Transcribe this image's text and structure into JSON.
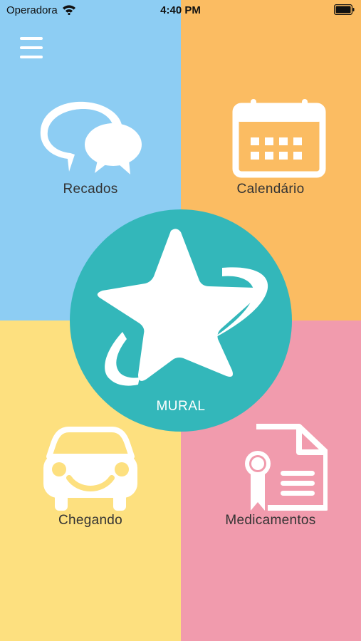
{
  "status_bar": {
    "carrier": "Operadora",
    "time": "4:40 PM",
    "icons": [
      "wifi-icon",
      "battery-icon"
    ]
  },
  "header": {
    "menu_icon": "hamburger-menu-icon"
  },
  "tiles": [
    {
      "label": "Recados",
      "icon": "speech-bubbles-icon",
      "color": "#8dcdf3"
    },
    {
      "label": "Calendário",
      "icon": "calendar-icon",
      "color": "#fbbc62"
    },
    {
      "label": "Chegando",
      "icon": "car-icon",
      "color": "#fde07f"
    },
    {
      "label": "Medicamentos",
      "icon": "prescription-document-icon",
      "color": "#f19bad"
    }
  ],
  "center": {
    "label": "MURAL",
    "icon": "star-logo-icon",
    "color": "#33b7ba"
  }
}
